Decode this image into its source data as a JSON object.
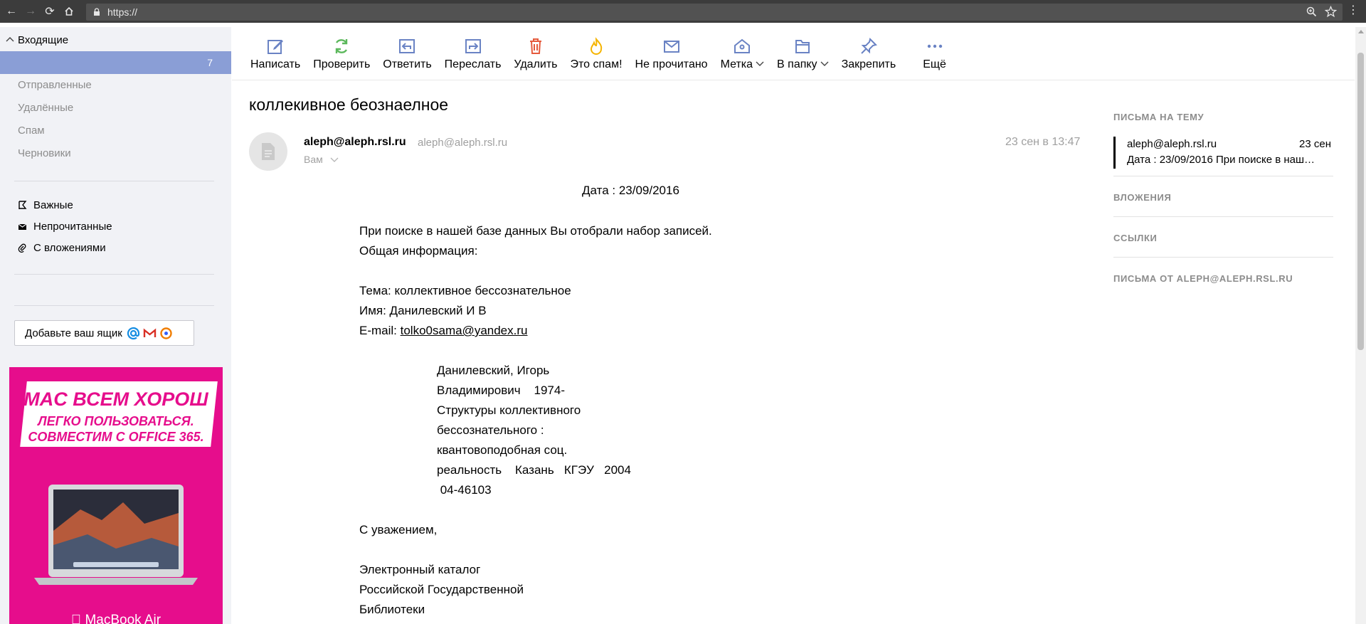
{
  "browser": {
    "url": "https://"
  },
  "sidebar": {
    "inbox_label": "Входящие",
    "inbox_count": "7",
    "folders": [
      "Отправленные",
      "Удалённые",
      "Спам",
      "Черновики"
    ],
    "filters": [
      "Важные",
      "Непрочитанные",
      "С вложениями"
    ],
    "add_mailbox_label": "Добавьте ваш ящик"
  },
  "ad": {
    "line1": "MAC ВСЕМ ХОРОШ",
    "line2": "ЛЕГКО ПОЛЬЗОВАТЬСЯ.",
    "line3": "СОВМЕСТИМ С OFFICE 365.",
    "brand": "MacBook Air"
  },
  "toolbar": {
    "compose": "Написать",
    "check": "Проверить",
    "reply": "Ответить",
    "forward": "Переслать",
    "delete": "Удалить",
    "spam": "Это спам!",
    "unread": "Не прочитано",
    "label": "Метка",
    "to_folder": "В папку",
    "pin": "Закрепить",
    "more": "Ещё"
  },
  "message": {
    "subject": "коллекивное беознаелное",
    "from_name": "aleph@aleph.rsl.ru",
    "from_email": "aleph@aleph.rsl.ru",
    "to": "Вам",
    "date": "23 сен в 13:47",
    "date_line": "Дата : 23/09/2016",
    "intro1": "При поиске в нашей базе данных Вы отобрали набор записей.",
    "intro2": "Общая информация:",
    "topic": "Тема: коллективное бессознательное",
    "name": "Имя: Данилевский И В",
    "email_prefix": "E-mail: ",
    "email_link": "tolko0sama@yandex.ru",
    "record": [
      "Данилевский, Игорь",
      "Владимирович    1974-",
      "Структуры коллективного",
      "бессознательного :",
      "квантовоподобная соц.",
      "реальность    Казань   КГЭУ   2004",
      " 04-46103"
    ],
    "regards": "С уважением,",
    "sign": [
      "Электронный каталог",
      "Российской Государственной",
      "Библиотеки"
    ]
  },
  "right_column": {
    "thread_title": "ПИСЬМА НА ТЕМУ",
    "thread_from": "aleph@aleph.rsl.ru",
    "thread_date": "23 сен",
    "thread_snippet": "Дата : 23/09/2016 При поиске в наш…",
    "attachments_title": "ВЛОЖЕНИЯ",
    "links_title": "ССЫЛКИ",
    "from_sender_title": "ПИСЬМА ОТ ALEPH@ALEPH.RSL.RU"
  },
  "colors": {
    "sidebar_bg": "#f1f2f6",
    "inbox_selected": "#8a9ed6",
    "toolbar_icon": "#6a83c4",
    "check_icon": "#5cb85c",
    "delete_icon": "#e55a3c",
    "spam_icon": "#f5b400",
    "ad_bg": "#e60d8c"
  }
}
